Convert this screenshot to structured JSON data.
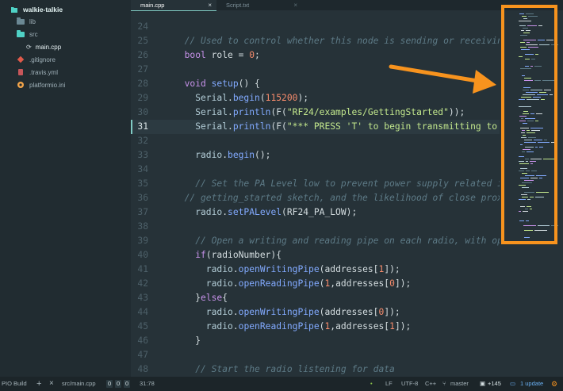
{
  "sidebar": {
    "root": "walkie-talkie",
    "items": [
      {
        "label": "lib",
        "kind": "folder"
      },
      {
        "label": "src",
        "kind": "folder-open"
      },
      {
        "label": "main.cpp",
        "kind": "file-cpp"
      },
      {
        "label": ".gitignore",
        "kind": "file-git"
      },
      {
        "label": ".travis.yml",
        "kind": "file-yml"
      },
      {
        "label": "platformio.ini",
        "kind": "file-pio"
      }
    ]
  },
  "tabs": [
    {
      "label": "main.cpp",
      "active": true
    },
    {
      "label": "Script.txt",
      "active": false
    }
  ],
  "editor": {
    "current_line": "31",
    "lines": [
      {
        "n": "24",
        "segs": []
      },
      {
        "n": "25",
        "segs": [
          {
            "t": "  // Used to control whether this node is sending or receiving",
            "c": "cmt"
          }
        ]
      },
      {
        "n": "26",
        "segs": [
          {
            "t": "  bool",
            "c": "kw"
          },
          {
            "t": " role = "
          },
          {
            "t": "0",
            "c": "num"
          },
          {
            "t": ";"
          }
        ]
      },
      {
        "n": "27",
        "segs": []
      },
      {
        "n": "28",
        "segs": [
          {
            "t": "  void",
            "c": "kw"
          },
          {
            "t": " "
          },
          {
            "t": "setup",
            "c": "fn"
          },
          {
            "t": "() {"
          }
        ]
      },
      {
        "n": "29",
        "segs": [
          {
            "t": "    Serial",
            "c": "cls"
          },
          {
            "t": "."
          },
          {
            "t": "begin",
            "c": "fn"
          },
          {
            "t": "("
          },
          {
            "t": "115200",
            "c": "num"
          },
          {
            "t": ");"
          }
        ]
      },
      {
        "n": "30",
        "segs": [
          {
            "t": "    Serial",
            "c": "cls"
          },
          {
            "t": "."
          },
          {
            "t": "println",
            "c": "fn"
          },
          {
            "t": "(F("
          },
          {
            "t": "\"RF24/examples/GettingStarted\"",
            "c": "str"
          },
          {
            "t": "));"
          }
        ]
      },
      {
        "n": "31",
        "segs": [
          {
            "t": "    Serial",
            "c": "cls"
          },
          {
            "t": "."
          },
          {
            "t": "println",
            "c": "fn"
          },
          {
            "t": "(F("
          },
          {
            "t": "\"*** PRESS 'T' to begin transmitting to the other n",
            "c": "str"
          }
        ]
      },
      {
        "n": "32",
        "segs": []
      },
      {
        "n": "33",
        "segs": [
          {
            "t": "    radio",
            "c": "cls"
          },
          {
            "t": "."
          },
          {
            "t": "begin",
            "c": "fn"
          },
          {
            "t": "();"
          }
        ]
      },
      {
        "n": "34",
        "segs": []
      },
      {
        "n": "35",
        "segs": [
          {
            "t": "    // Set the PA Level low to prevent power supply related issues since",
            "c": "cmt"
          }
        ]
      },
      {
        "n": "36",
        "segs": [
          {
            "t": "  // getting_started sketch, and the likelihood of close proximity of t",
            "c": "cmt"
          }
        ]
      },
      {
        "n": "37",
        "segs": [
          {
            "t": "    radio",
            "c": "cls"
          },
          {
            "t": "."
          },
          {
            "t": "setPALevel",
            "c": "fn"
          },
          {
            "t": "(RF24_PA_LOW);"
          }
        ]
      },
      {
        "n": "38",
        "segs": []
      },
      {
        "n": "39",
        "segs": [
          {
            "t": "    // Open a writing and reading pipe on each radio, with opposite",
            "c": "cmt"
          }
        ]
      },
      {
        "n": "40",
        "segs": [
          {
            "t": "    if",
            "c": "kw"
          },
          {
            "t": "(radioNumber){"
          }
        ]
      },
      {
        "n": "41",
        "segs": [
          {
            "t": "      radio",
            "c": "cls"
          },
          {
            "t": "."
          },
          {
            "t": "openWritingPipe",
            "c": "fn"
          },
          {
            "t": "(addresses["
          },
          {
            "t": "1",
            "c": "num"
          },
          {
            "t": "]);"
          }
        ]
      },
      {
        "n": "42",
        "segs": [
          {
            "t": "      radio",
            "c": "cls"
          },
          {
            "t": "."
          },
          {
            "t": "openReadingPipe",
            "c": "fn"
          },
          {
            "t": "("
          },
          {
            "t": "1",
            "c": "num"
          },
          {
            "t": ",addresses["
          },
          {
            "t": "0",
            "c": "num"
          },
          {
            "t": "]);"
          }
        ]
      },
      {
        "n": "43",
        "segs": [
          {
            "t": "    }"
          },
          {
            "t": "else",
            "c": "kw"
          },
          {
            "t": "{"
          }
        ]
      },
      {
        "n": "44",
        "segs": [
          {
            "t": "      radio",
            "c": "cls"
          },
          {
            "t": "."
          },
          {
            "t": "openWritingPipe",
            "c": "fn"
          },
          {
            "t": "(addresses["
          },
          {
            "t": "0",
            "c": "num"
          },
          {
            "t": "]);"
          }
        ]
      },
      {
        "n": "45",
        "segs": [
          {
            "t": "      radio",
            "c": "cls"
          },
          {
            "t": "."
          },
          {
            "t": "openReadingPipe",
            "c": "fn"
          },
          {
            "t": "("
          },
          {
            "t": "1",
            "c": "num"
          },
          {
            "t": ",addresses["
          },
          {
            "t": "1",
            "c": "num"
          },
          {
            "t": "]);"
          }
        ]
      },
      {
        "n": "46",
        "segs": [
          {
            "t": "    }"
          }
        ]
      },
      {
        "n": "47",
        "segs": []
      },
      {
        "n": "48",
        "segs": [
          {
            "t": "    // Start the radio listening for data",
            "c": "cmt"
          }
        ]
      }
    ]
  },
  "statusbar": {
    "build": "PIO Build",
    "plus": "+",
    "close": "×",
    "file": "src/main.cpp",
    "counts": [
      "0",
      "0",
      "0"
    ],
    "cursor": "31:78",
    "eol": "LF",
    "encoding": "UTF-8",
    "grammar": "C++",
    "branch": "master",
    "diff": "+145",
    "update": "1 update"
  },
  "colors": {
    "annotation": "#f7931e",
    "accent": "#80cbc4"
  }
}
